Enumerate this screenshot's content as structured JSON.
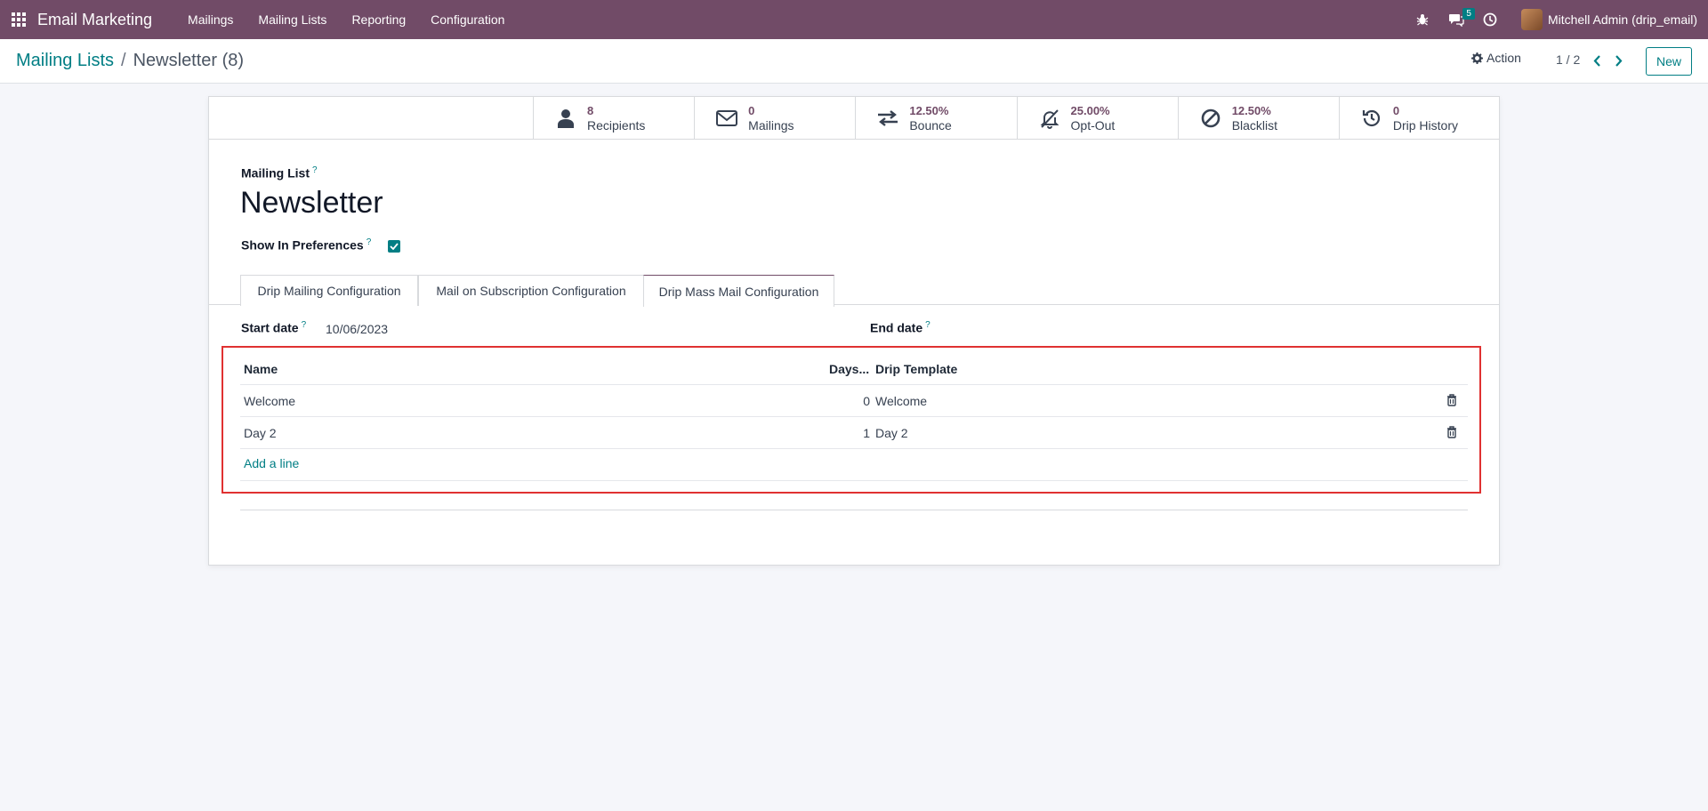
{
  "navbar": {
    "app_title": "Email Marketing",
    "menu": [
      "Mailings",
      "Mailing Lists",
      "Reporting",
      "Configuration"
    ],
    "messages_badge": "5",
    "user_name": "Mitchell Admin (drip_email)",
    "colors": {
      "brand": "#714b67",
      "accent": "#017e84"
    }
  },
  "control_panel": {
    "breadcrumb_parent": "Mailing Lists",
    "breadcrumb_separator": "/",
    "breadcrumb_current": "Newsletter (8)",
    "action_label": "Action",
    "pager": "1 / 2",
    "new_label": "New"
  },
  "stats": [
    {
      "value": "8",
      "label": "Recipients",
      "icon": "user-icon"
    },
    {
      "value": "0",
      "label": "Mailings",
      "icon": "envelope-icon"
    },
    {
      "value": "12.50%",
      "label": "Bounce",
      "icon": "exchange-icon"
    },
    {
      "value": "25.00%",
      "label": "Opt-Out",
      "icon": "bell-slash-icon"
    },
    {
      "value": "12.50%",
      "label": "Blacklist",
      "icon": "ban-icon"
    },
    {
      "value": "0",
      "label": "Drip History",
      "icon": "history-icon"
    }
  ],
  "form": {
    "mailing_list_label": "Mailing List",
    "help_mark": "?",
    "title": "Newsletter",
    "show_in_preferences_label": "Show In Preferences",
    "show_in_preferences": true
  },
  "tabs": [
    {
      "label": "Drip Mailing Configuration",
      "active": false
    },
    {
      "label": "Mail on Subscription Configuration",
      "active": false
    },
    {
      "label": "Drip Mass Mail Configuration",
      "active": true
    }
  ],
  "drip": {
    "start_date_label": "Start date",
    "start_date": "10/06/2023",
    "end_date_label": "End date",
    "columns": {
      "name": "Name",
      "days": "Days...",
      "template": "Drip Template"
    },
    "rows": [
      {
        "name": "Welcome",
        "days": "0",
        "template": "Welcome"
      },
      {
        "name": "Day 2",
        "days": "1",
        "template": "Day 2"
      }
    ],
    "add_line_label": "Add a line"
  }
}
